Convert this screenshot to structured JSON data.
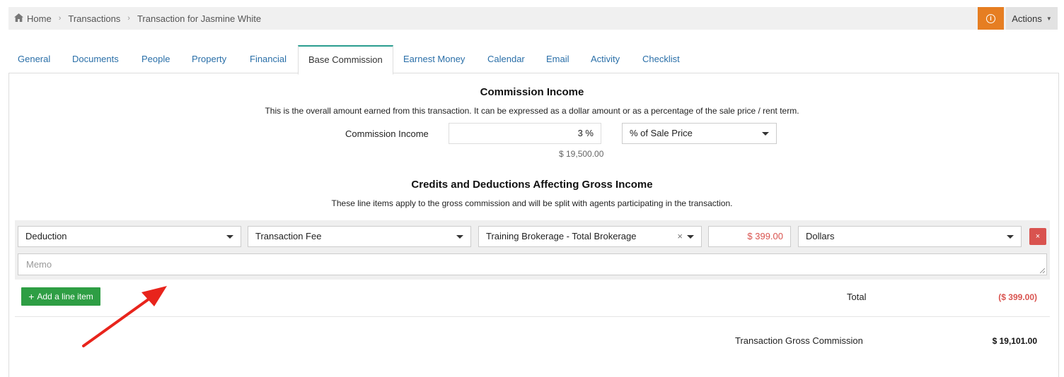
{
  "breadcrumb": {
    "home": "Home",
    "transactions": "Transactions",
    "current": "Transaction for Jasmine White"
  },
  "header": {
    "actions_label": "Actions",
    "info_icon": "info-icon"
  },
  "tabs": [
    {
      "label": "General"
    },
    {
      "label": "Documents"
    },
    {
      "label": "People"
    },
    {
      "label": "Property"
    },
    {
      "label": "Financial"
    },
    {
      "label": "Base Commission",
      "active": true
    },
    {
      "label": "Earnest Money"
    },
    {
      "label": "Calendar"
    },
    {
      "label": "Email"
    },
    {
      "label": "Activity"
    },
    {
      "label": "Checklist"
    }
  ],
  "commission": {
    "title": "Commission Income",
    "description": "This is the overall amount earned from this transaction. It can be expressed as a dollar amount or as a percentage of the sale price / rent term.",
    "label": "Commission Income",
    "value": "3 %",
    "unit": "% of Sale Price",
    "computed": "$ 19,500.00"
  },
  "credits": {
    "title": "Credits and Deductions Affecting Gross Income",
    "description": "These line items apply to the gross commission and will be split with agents participating in the transaction.",
    "line_item": {
      "type": "Deduction",
      "category": "Transaction Fee",
      "payee": "Training Brokerage - Total Brokerage",
      "amount": "$ 399.00",
      "unit": "Dollars",
      "memo_placeholder": "Memo",
      "clear": "×",
      "remove": "×"
    },
    "add_label": "Add a line item",
    "total_label": "Total",
    "total_value": "($ 399.00)"
  },
  "gross": {
    "label": "Transaction Gross Commission",
    "value": "$ 19,101.00"
  },
  "colors": {
    "accent_orange": "#e67e22",
    "link_blue": "#2a6fa8",
    "danger_red": "#d9534f",
    "success_green": "#2e9e44",
    "annotation_arrow": "#e8241c"
  }
}
